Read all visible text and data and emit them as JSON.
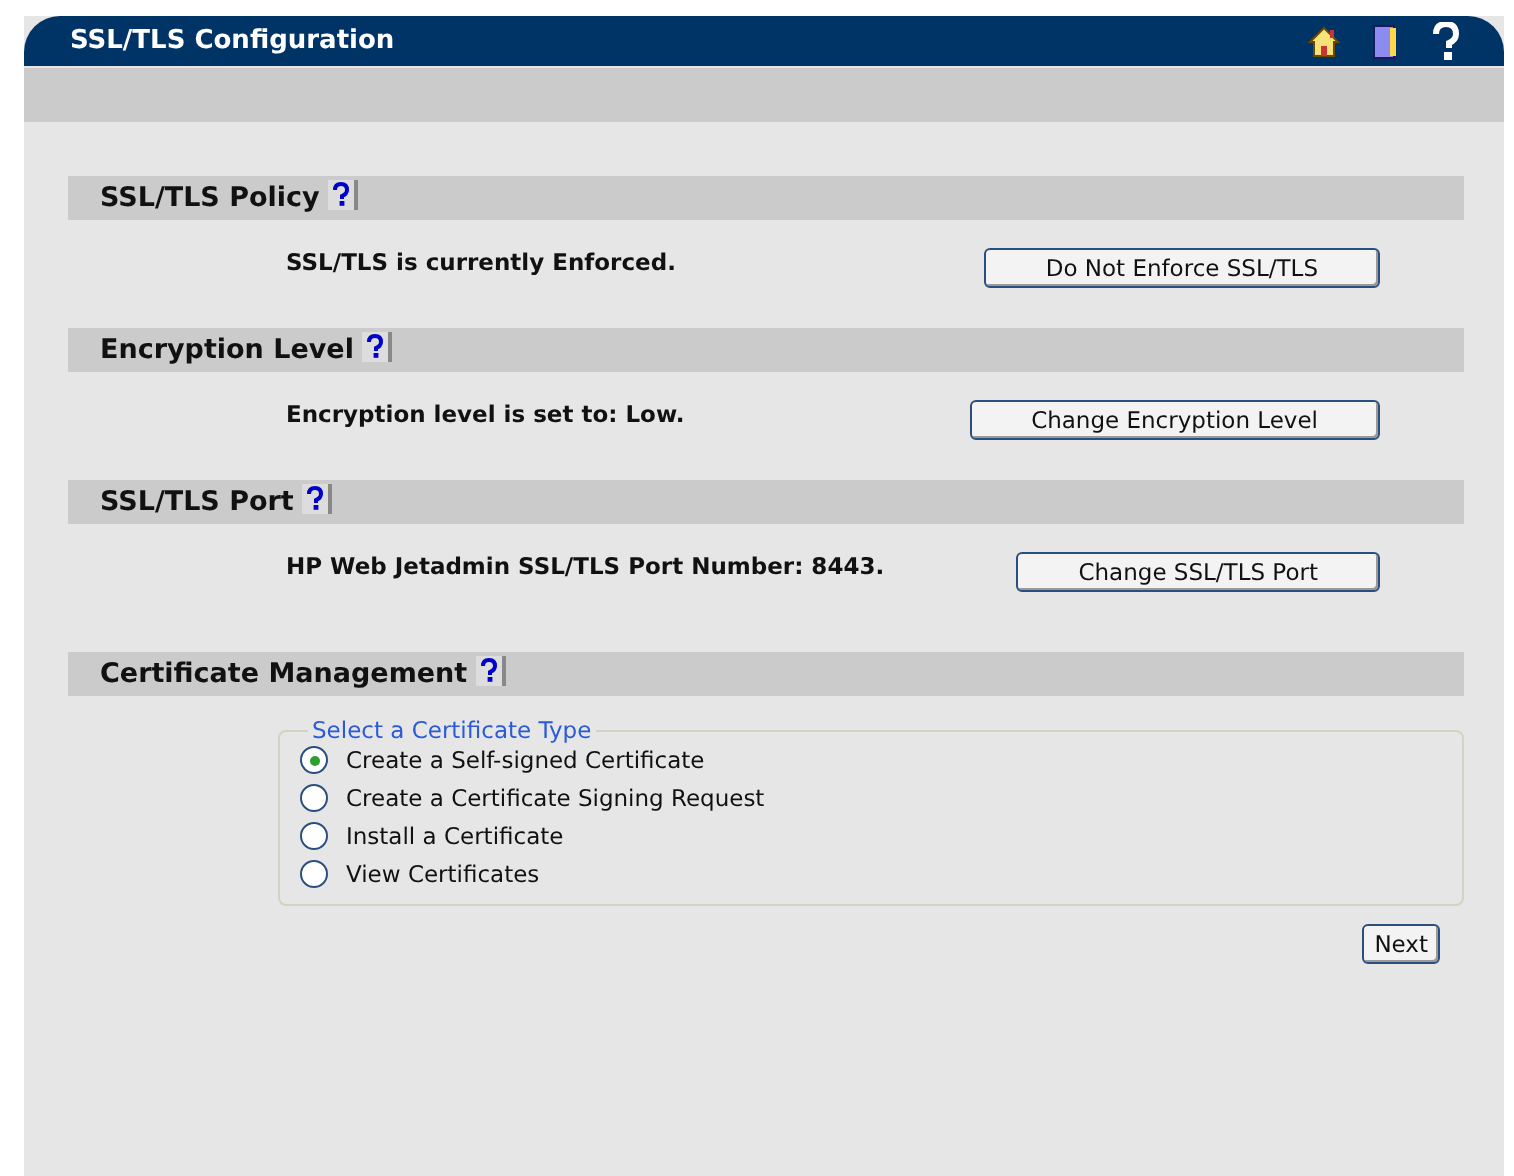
{
  "window": {
    "title": "SSL/TLS Configuration"
  },
  "sections": [
    {
      "kind": "action",
      "title": "SSL/TLS Policy",
      "message": "SSL/TLS is currently Enforced.",
      "button": "Do Not Enforce SSL/TLS"
    },
    {
      "kind": "action",
      "title": "Encryption Level",
      "message": "Encryption level is set to: Low.",
      "button": "Change Encryption Level"
    },
    {
      "kind": "action",
      "title": "SSL/TLS Port",
      "message": "HP Web Jetadmin SSL/TLS Port Number: 8443.",
      "button": "Change SSL/TLS Port"
    },
    {
      "kind": "choice",
      "title": "Certificate Management",
      "legend": "Select a Certificate Type",
      "options": [
        {
          "label": "Create a Self-signed Certificate",
          "selected": true
        },
        {
          "label": "Create a Certificate Signing Request",
          "selected": false
        },
        {
          "label": "Install a Certificate",
          "selected": false
        },
        {
          "label": "View Certificates",
          "selected": false
        }
      ],
      "button": "Next"
    }
  ]
}
